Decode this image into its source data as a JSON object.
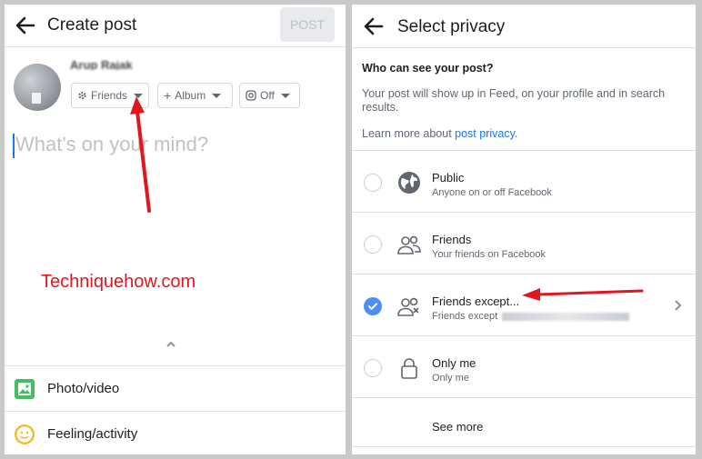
{
  "create_post": {
    "title": "Create post",
    "post_button": "POST",
    "user_name": "Arup Rajak",
    "chips": {
      "friends": "Friends",
      "album": "Album",
      "instagram": "Off"
    },
    "composer_placeholder": "What's on your mind?",
    "actions": [
      {
        "label": "Photo/video",
        "icon": "photo-icon"
      },
      {
        "label": "Feeling/activity",
        "icon": "smiley-icon"
      }
    ]
  },
  "watermark": "Techniquehow.com",
  "select_privacy": {
    "title": "Select privacy",
    "question": "Who can see your post?",
    "description": "Your post will show up in Feed, on your profile and in search results.",
    "learn_prefix": "Learn more about ",
    "learn_link": "post privacy",
    "learn_suffix": ".",
    "options": [
      {
        "label": "Public",
        "sub": "Anyone on or off Facebook",
        "icon": "globe-icon",
        "selected": false
      },
      {
        "label": "Friends",
        "sub": "Your friends on Facebook",
        "icon": "friends-icon",
        "selected": false
      },
      {
        "label": "Friends except...",
        "sub": "Friends except ",
        "icon": "friends-except-icon",
        "selected": true
      },
      {
        "label": "Only me",
        "sub": "Only me",
        "icon": "lock-icon",
        "selected": false
      }
    ],
    "see_more": "See more"
  },
  "colors": {
    "accent": "#1877f2",
    "radio_selected": "#4d8ef5",
    "annotation_arrow": "#e1171e"
  }
}
